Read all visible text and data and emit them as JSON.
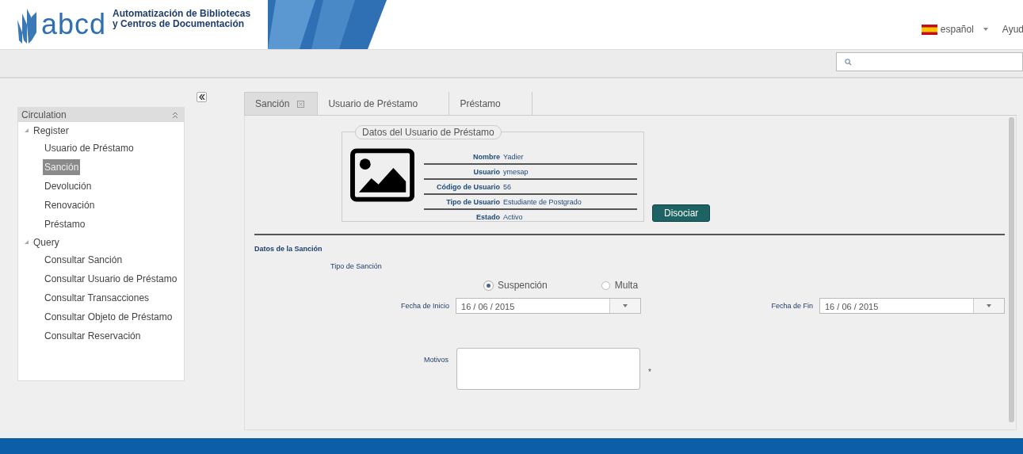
{
  "header": {
    "logo_text": "abcd",
    "subtitle_lines": [
      "Automatización de Bibliotecas",
      "y Centros de Documentación"
    ],
    "language": "español",
    "help": "Ayud"
  },
  "sidebar": {
    "title": "Circulation",
    "items": [
      {
        "label": "Register",
        "expanded": true,
        "children": [
          {
            "label": "Usuario de Préstamo",
            "selected": false
          },
          {
            "label": "Sanción",
            "selected": true
          },
          {
            "label": "Devolución",
            "selected": false
          },
          {
            "label": "Renovación",
            "selected": false
          },
          {
            "label": "Préstamo",
            "selected": false
          }
        ]
      },
      {
        "label": "Query",
        "expanded": true,
        "children": [
          {
            "label": "Consultar Sanción",
            "selected": false
          },
          {
            "label": "Consultar Usuario de Préstamo",
            "selected": false
          },
          {
            "label": "Consultar Transacciones",
            "selected": false
          },
          {
            "label": "Consultar Objeto de Préstamo",
            "selected": false
          },
          {
            "label": "Consultar Reservación",
            "selected": false
          }
        ]
      }
    ]
  },
  "tabs": [
    {
      "label": "Sanción",
      "selected": true,
      "closable": true
    },
    {
      "label": "Usuario de Préstamo",
      "selected": false,
      "closable": false
    },
    {
      "label": "Préstamo",
      "selected": false,
      "closable": false
    }
  ],
  "user_panel": {
    "legend": "Datos del Usuario de Préstamo",
    "fields": [
      {
        "label": "Nombre",
        "value": "Yadier"
      },
      {
        "label": "Usuario",
        "value": "ymesap"
      },
      {
        "label": "Código de Usuario",
        "value": "56"
      },
      {
        "label": "Tipo de Usuario",
        "value": "Estudiante de Postgrado"
      },
      {
        "label": "Estado",
        "value": "Activo"
      }
    ],
    "button": "Disociar"
  },
  "sanction": {
    "title": "Datos de la Sanción",
    "type_label": "Tipo de Sanción",
    "options": [
      {
        "label": "Suspención",
        "selected": true
      },
      {
        "label": "Multa",
        "selected": false
      }
    ],
    "start_label": "Fecha de Inicio",
    "start_value": "16 / 06 / 2015",
    "end_label": "Fecha de Fin",
    "end_value": "16 / 06 / 2015",
    "reasons_label": "Motivos",
    "required_mark": "*"
  }
}
